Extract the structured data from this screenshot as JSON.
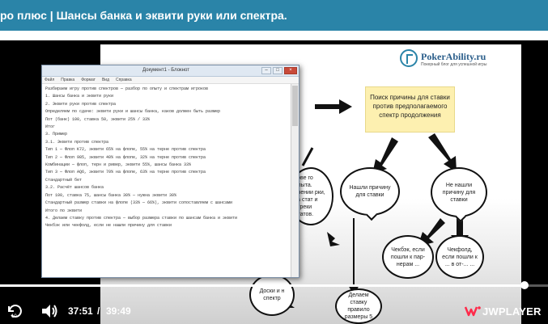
{
  "page": {
    "title": "ро плюс | Шансы банка и эквити руки или спектра."
  },
  "slide": {
    "logo_text": "PokerAbility.ru",
    "logo_sub": "Покерный блог для успешной игры",
    "yellow_box": "Поиск причины для ставки против предполагаемого спектр продолжения",
    "bubble_left_top": "зове го опыта. ачении рки, та стат и игреки статов.",
    "bubble_center": "Нашли причину для ставки",
    "bubble_right": "Не нашли причину для ставки",
    "bubble_bottom_left": "Доски и н спектр",
    "bubble_bottom_center": "Делаем ставку правило размеры 5",
    "bubble_bottom_right1": "Чекбэк, если пошли к пар-нерам ...",
    "bubble_bottom_right2": "Чекфолд, если пошли к ... в от-... ...",
    "arrow_text": "Делаем ставку правило размеры 55"
  },
  "notepad": {
    "title": "Документ1 - Блокнот",
    "menu": [
      "Файл",
      "Правка",
      "Формат",
      "Вид",
      "Справка"
    ],
    "lines": [
      "Разбираем игру против спектров — разбор по опыту и спектрам игроков",
      "1. Шансы банка и эквити руки",
      "2. Эквити руки против спектра",
      "Определяем по сдаче: эквити руки и шансы банка, каков должен быть размер",
      "Пот (банк) 100, ставка 50, эквити 25% / 33%",
      "Итог",
      "3. Пример",
      "3.1. Эквити против спектра",
      "Тип 1 — Флоп K72, эквити 65% на флопе, 55% на терне против спектра",
      "Тип 2 — Флоп 985, эквити 40% на флопе, 32% на терне против спектра",
      "Комбинации — флоп, терн и ривер, эквити 55%, шансы банка 33%",
      "Тип 3 — Флоп AQ6, эквити 70% на флопе, 63% на терне против спектра",
      "Стандартный бет",
      "3.2. Расчёт шансов банка",
      "Пот 100, ставка 75, шансы банка 30% — нужна эквити 30%",
      "Стандартный размер ставки на флопе (33% — 66%), эквити сопоставляем с шансами",
      "Итого по эквити",
      "4. Делаем ставку против спектра — выбор размера ставки по шансам банка и эквити",
      "Чекбэк или чекфолд, если не нашли причину для ставки"
    ]
  },
  "player": {
    "progress": 0.9573,
    "current_time": "37:51",
    "separator": "/",
    "duration": "39:49",
    "brand": "JWPLAYER",
    "rewind_label": "10"
  }
}
